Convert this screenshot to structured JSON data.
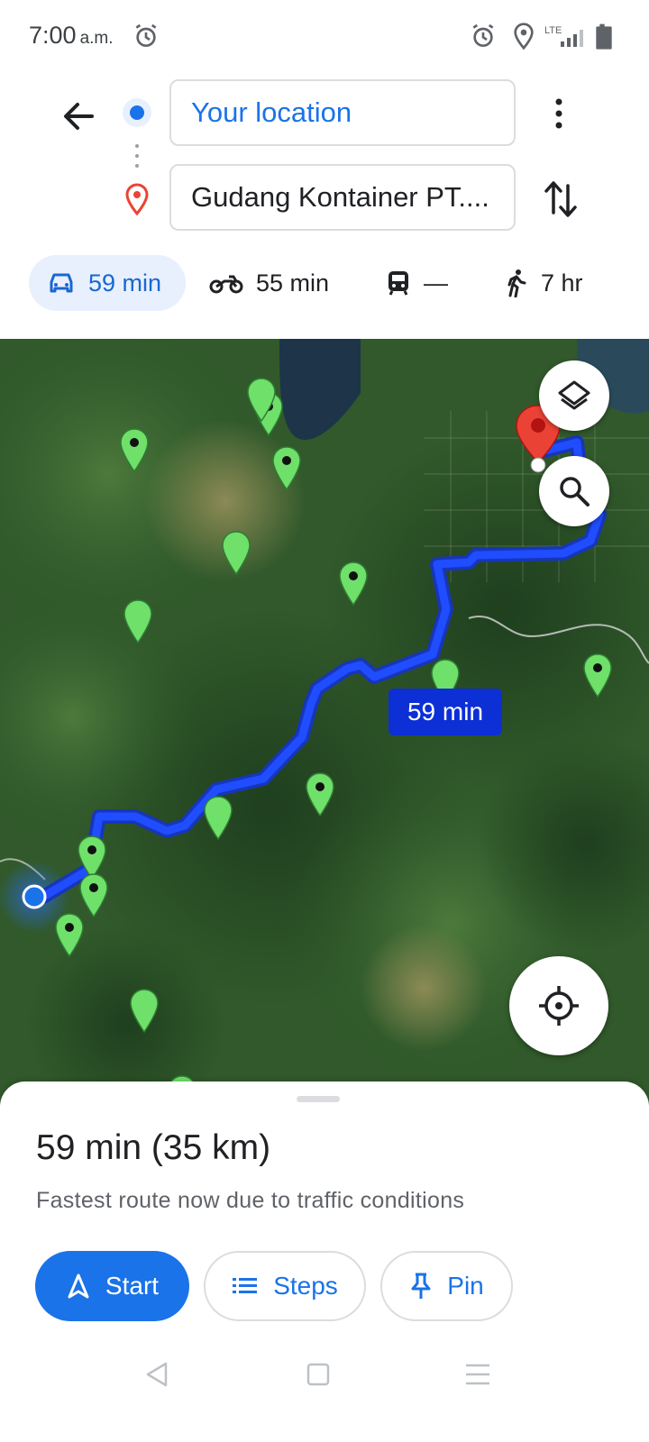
{
  "status_bar": {
    "time": "7:00",
    "ampm": "a.m.",
    "network": "LTE",
    "icons": [
      "alarm-icon",
      "location-icon",
      "lte-signal-icon",
      "battery-icon"
    ]
  },
  "directions": {
    "origin": "Your location",
    "destination": "Gudang Kontainer PT...."
  },
  "modes": [
    {
      "name": "car",
      "duration": "59 min",
      "selected": true
    },
    {
      "name": "motorcycle",
      "duration": "55 min",
      "selected": false
    },
    {
      "name": "transit",
      "duration": "—",
      "selected": false
    },
    {
      "name": "walk",
      "duration": "7 hr",
      "selected": false
    }
  ],
  "map": {
    "route_label": "59 min",
    "route_color": "#1a3cff",
    "marker_color": "#6fe06a",
    "icons": [
      "layers-icon",
      "search-icon",
      "my-location-icon",
      "destination-pin-icon"
    ]
  },
  "route_summary": {
    "duration_distance": "59 min (35 km)",
    "note": "Fastest route now due to traffic conditions"
  },
  "actions": {
    "start_label": "Start",
    "steps_label": "Steps",
    "pin_label": "Pin"
  },
  "colors": {
    "accent": "#1a73e8",
    "selected_mode_bg": "#e8f0fe",
    "destination_red": "#ea4335"
  }
}
